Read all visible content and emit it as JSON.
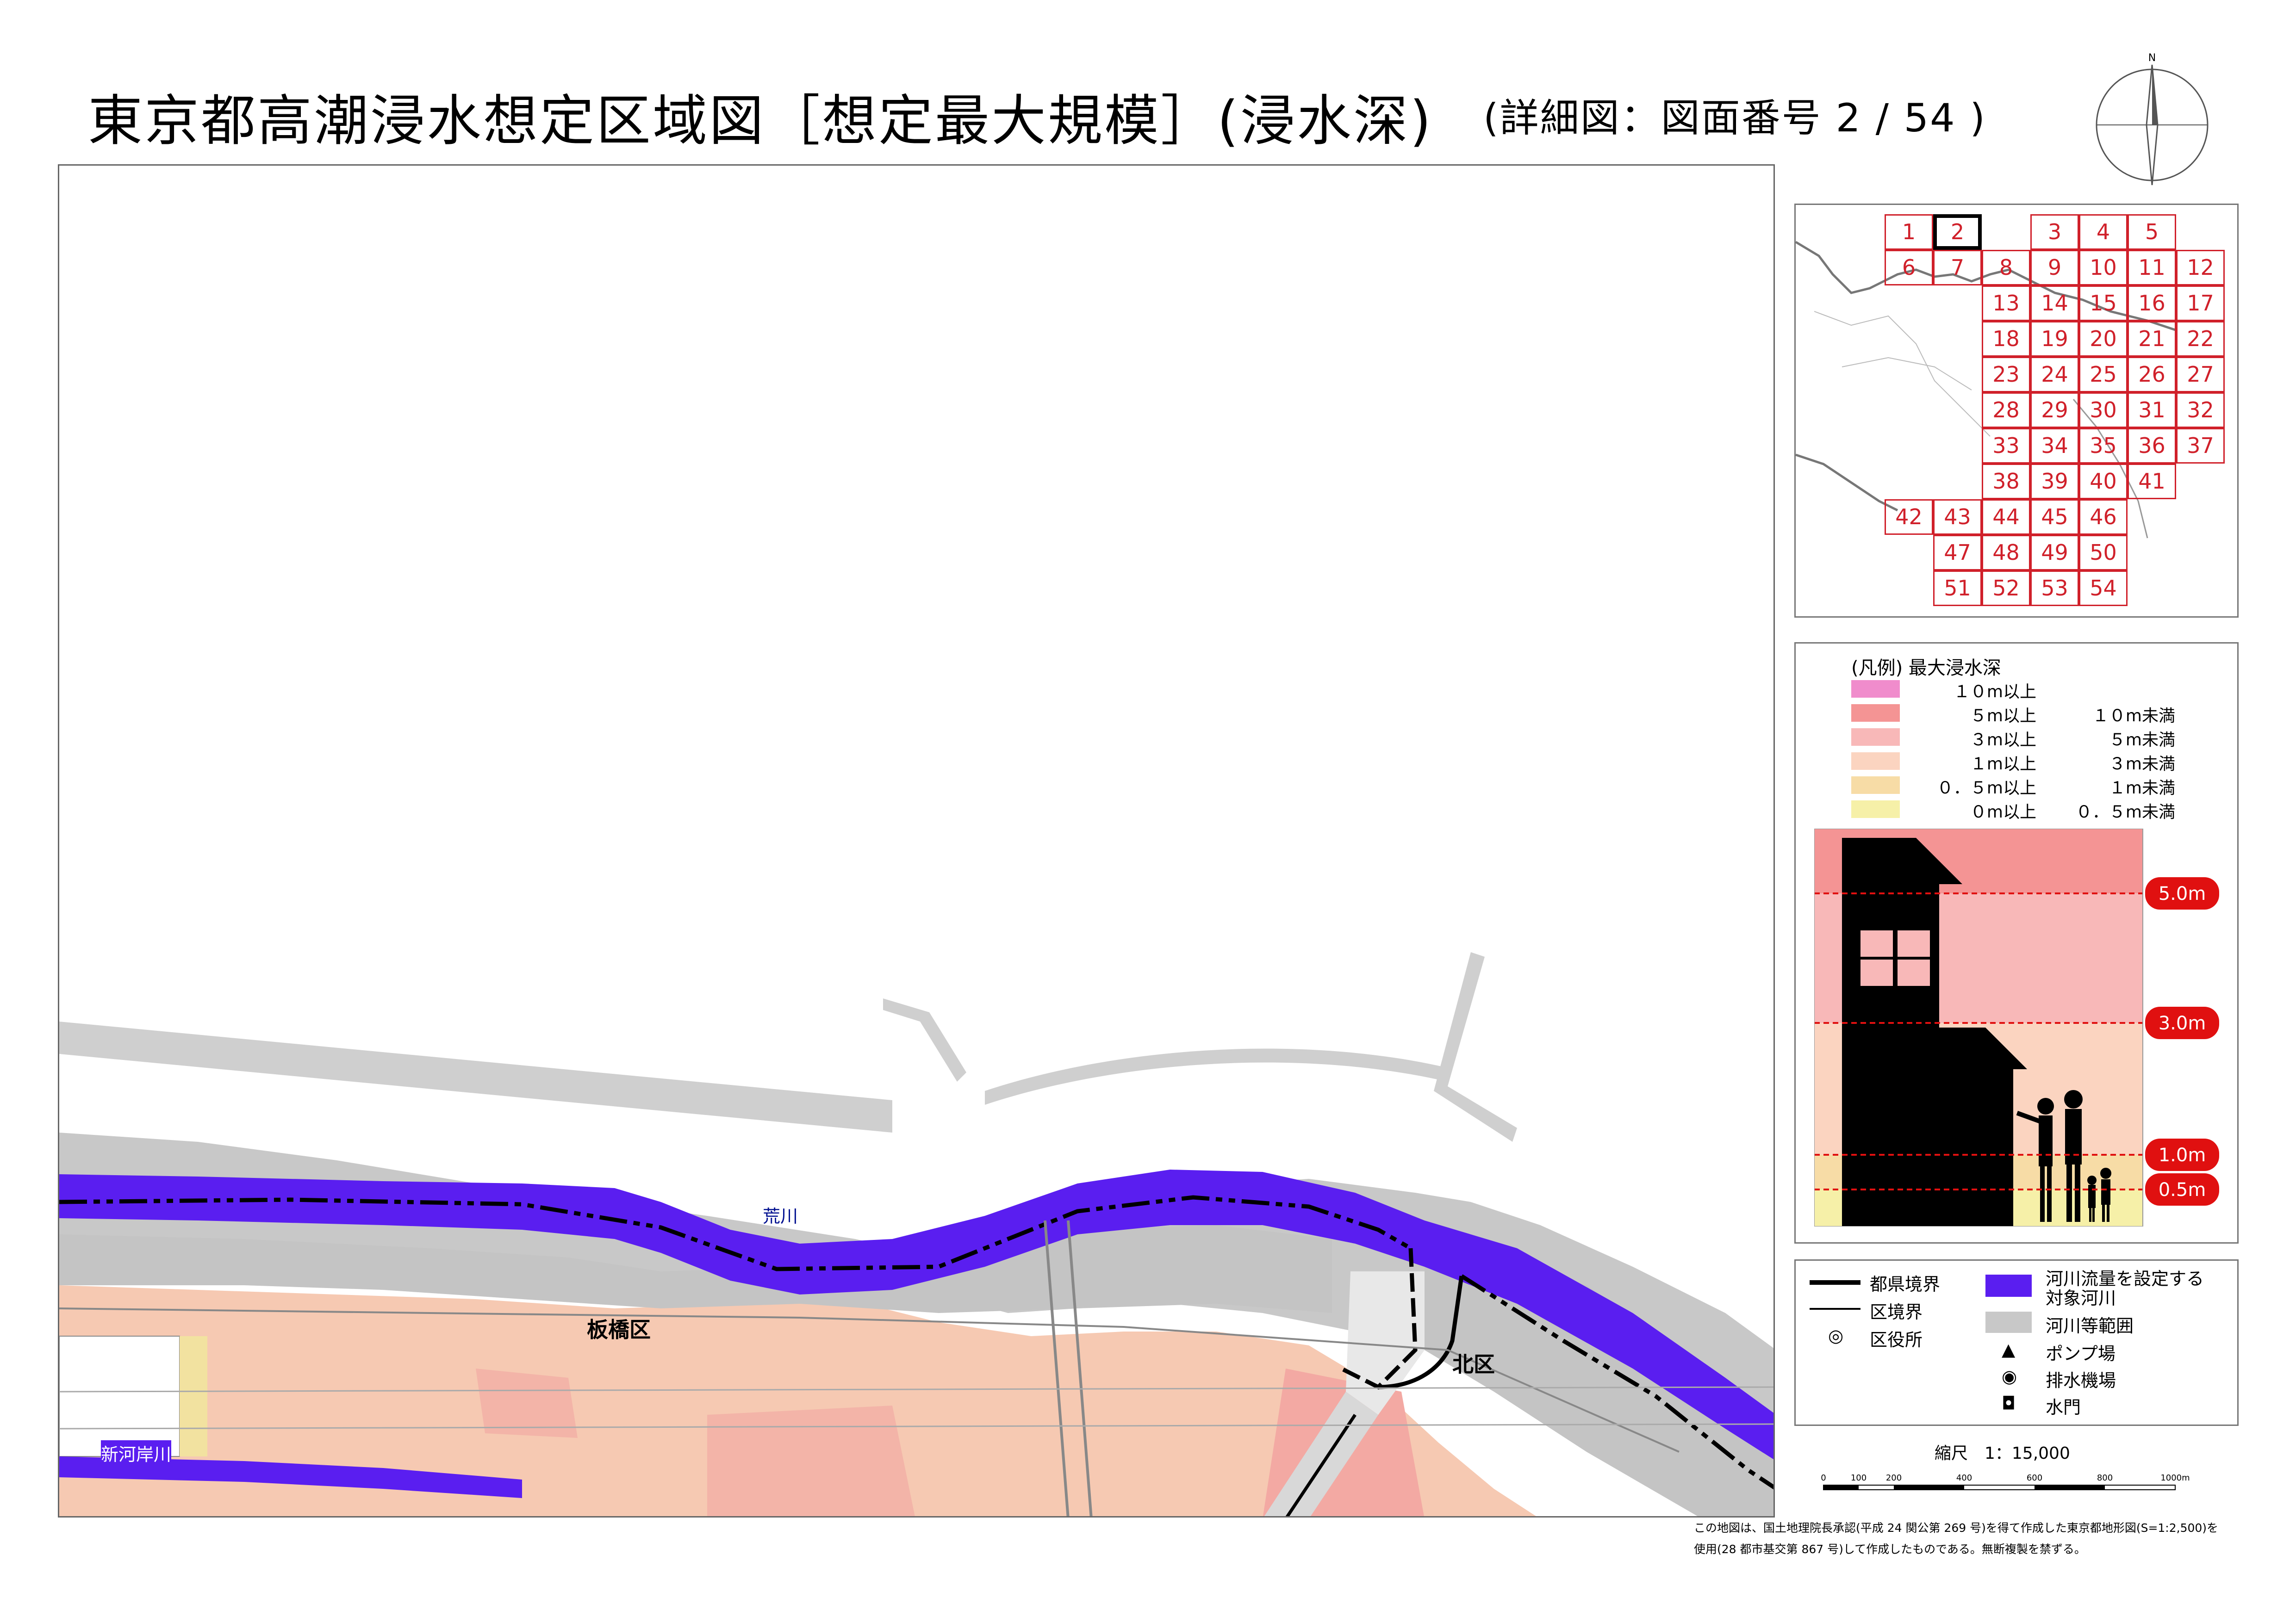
{
  "title": "東京都高潮浸水想定区域図［想定最大規模］(浸水深)",
  "subtitle": "(詳細図：図面番号 2 / 54 )",
  "north_label": "N",
  "index_map": {
    "rows": [
      [
        "1",
        "2",
        "",
        "3",
        "4",
        "5",
        ""
      ],
      [
        "6",
        "7",
        "8",
        "9",
        "10",
        "11",
        "12"
      ],
      [
        "",
        "",
        "13",
        "14",
        "15",
        "16",
        "17"
      ],
      [
        "",
        "",
        "18",
        "19",
        "20",
        "21",
        "22"
      ],
      [
        "",
        "",
        "23",
        "24",
        "25",
        "26",
        "27"
      ],
      [
        "",
        "",
        "28",
        "29",
        "30",
        "31",
        "32"
      ],
      [
        "",
        "",
        "33",
        "34",
        "35",
        "36",
        "37"
      ],
      [
        "",
        "",
        "38",
        "39",
        "40",
        "41",
        ""
      ],
      [
        "42",
        "43",
        "44",
        "45",
        "46",
        "",
        ""
      ],
      [
        "",
        "47",
        "48",
        "49",
        "50",
        "",
        ""
      ],
      [
        "",
        "51",
        "52",
        "53",
        "54",
        "",
        ""
      ]
    ],
    "current_sheet": "2",
    "grid_color": "#d0202a"
  },
  "legend": {
    "title": "(凡例) 最大浸水深",
    "items": [
      {
        "color": "#f08ccc",
        "lower": "１０m以上",
        "upper": ""
      },
      {
        "color": "#f49494",
        "lower": "５m以上",
        "upper": "１０m未満"
      },
      {
        "color": "#f8b8b8",
        "lower": "３m以上",
        "upper": "５m未満"
      },
      {
        "color": "#fbd4c0",
        "lower": "１m以上",
        "upper": "３m未満"
      },
      {
        "color": "#f7dca6",
        "lower": "０．５m以上",
        "upper": "１m未満"
      },
      {
        "color": "#f6f0a8",
        "lower": "０m以上",
        "upper": "０．５m未満"
      }
    ],
    "depth_markers": [
      "5.0m",
      "3.0m",
      "1.0m",
      "0.5m"
    ]
  },
  "symbols": {
    "prefecture_boundary": "都県境界",
    "ward_boundary": "区境界",
    "ward_office": "区役所",
    "target_river": "河川流量を設定する\n対象河川",
    "river_area": "河川等範囲",
    "pump_station": "ポンプ場",
    "drainage_station": "排水機場",
    "water_gate": "水門",
    "target_river_line1": "河川流量を設定する",
    "target_river_line2": "対象河川"
  },
  "scale": {
    "label": "縮尺　1：15,000",
    "ticks": [
      "0",
      "100",
      "200",
      "400",
      "600",
      "800",
      "1000m"
    ]
  },
  "map_labels": {
    "arakawa": "荒川",
    "itabashi": "板橋区",
    "kita": "北区",
    "shingashi": "新河岸川"
  },
  "colors": {
    "river_blue": "#5a1ef0",
    "river_area_gray": "#c8c8c8",
    "inundation_main": "#f6c9b2",
    "marker_red": "#e01010"
  },
  "credit": {
    "line1": "この地図は、国土地理院長承認(平成 24 関公第 269 号)を得て作成した東京都地形図(S=1:2,500)を",
    "line2": "使用(28 都市基交第 867 号)して作成したものである。無断複製を禁ずる。"
  }
}
